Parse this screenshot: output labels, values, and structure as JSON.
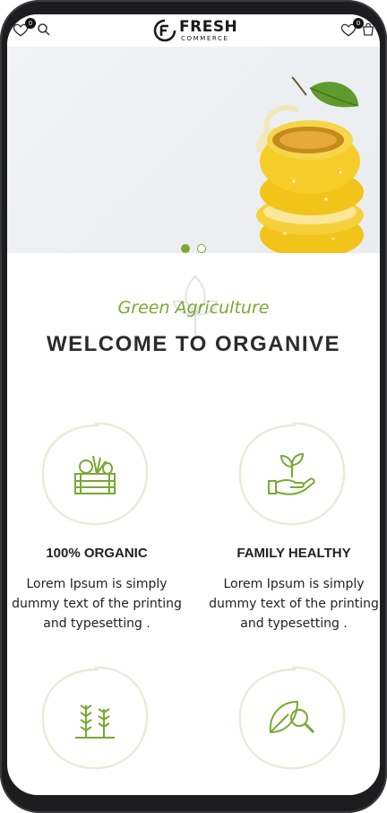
{
  "header": {
    "logo_main": "FRESH",
    "logo_sub": "COMMERCE",
    "left_badge": "0",
    "right_badge": "0",
    "icons": [
      "heart-icon",
      "search-icon",
      "heart-icon",
      "cart-icon"
    ]
  },
  "hero": {
    "image": "lemon-splash-photo",
    "slides_total": 2,
    "active_slide": 1
  },
  "intro": {
    "subtitle": "Green Agriculture",
    "title": "WELCOME TO ORGANIVE"
  },
  "features": [
    {
      "title": "100% ORGANIC",
      "text": "Lorem Ipsum is simply dummy text of the printing and typesetting .",
      "icon": "vegetable-crate-icon"
    },
    {
      "title": "FAMILY HEALTHY",
      "text": "Lorem Ipsum is simply dummy text of the printing and typesetting .",
      "icon": "hand-sprout-icon"
    },
    {
      "title": "",
      "text": "",
      "icon": "wheat-icon"
    },
    {
      "title": "",
      "text": "",
      "icon": "leaf-search-icon"
    }
  ],
  "colors": {
    "accent": "#7aa832",
    "title": "#2b2b2b",
    "frame": "#1d1d1f"
  }
}
